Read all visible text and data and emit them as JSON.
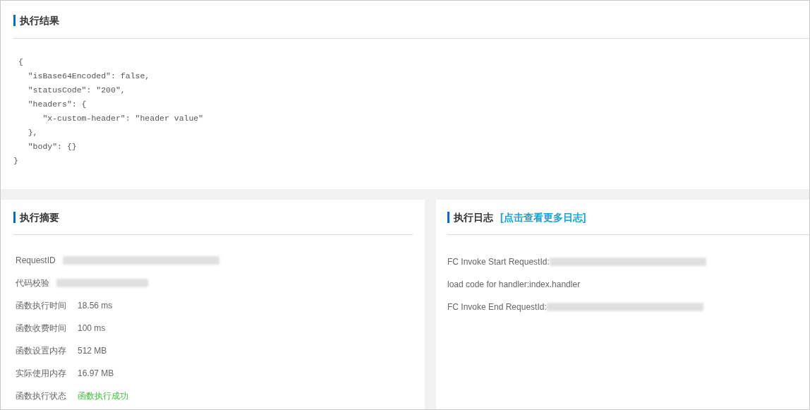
{
  "result": {
    "title": "执行结果",
    "code_lines": [
      " {",
      "   \"isBase64Encoded\": false,",
      "   \"statusCode\": \"200\",",
      "   \"headers\": {",
      "      \"x-custom-header\": \"header value\"",
      "   },",
      "   \"body\": {}",
      "}"
    ]
  },
  "summary": {
    "title": "执行摘要",
    "rows": [
      {
        "label": "RequestID",
        "redacted": true
      },
      {
        "label": "代码校验",
        "redacted": true
      },
      {
        "label": "函数执行时间",
        "value": "18.56 ms",
        "redacted": false,
        "kind": "plain"
      },
      {
        "label": "函数收费时间",
        "value": "100 ms",
        "redacted": false,
        "kind": "plain"
      },
      {
        "label": "函数设置内存",
        "value": "512 MB",
        "redacted": false,
        "kind": "plain"
      },
      {
        "label": "实际使用内存",
        "value": "16.97 MB",
        "redacted": false,
        "kind": "plain"
      },
      {
        "label": "函数执行状态",
        "value": "函数执行成功",
        "redacted": false,
        "kind": "success"
      }
    ]
  },
  "log": {
    "title": "执行日志",
    "link": "[点击查看更多日志]",
    "lines": [
      {
        "text": "FC Invoke Start RequestId:",
        "redacted": true
      },
      {
        "text": "load code for handler:index.handler",
        "redacted": false
      },
      {
        "text": "FC Invoke End RequestId:",
        "redacted": true
      }
    ]
  }
}
